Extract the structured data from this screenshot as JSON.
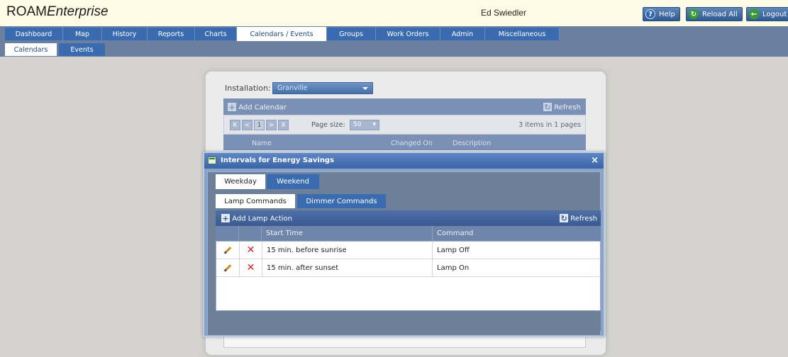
{
  "app": {
    "brand_plain": "ROAM",
    "brand_italic": "Enterprise",
    "user_name": "Ed Swiedler"
  },
  "header_buttons": [
    {
      "label": "Help",
      "icon": "help-icon",
      "color": "#2f64b2"
    },
    {
      "label": "Reload All",
      "icon": "reload-icon",
      "color": "#3a9a32"
    },
    {
      "label": "Logout",
      "icon": "logout-icon",
      "color": "#3a9a32"
    }
  ],
  "nav": {
    "tabs": [
      "Dashboard",
      "Map",
      "History",
      "Reports",
      "Charts",
      "Calendars / Events",
      "Groups",
      "Work Orders",
      "Admin",
      "Miscellaneous"
    ],
    "active": "Calendars / Events"
  },
  "subnav": {
    "tabs": [
      "Calendars",
      "Events"
    ],
    "active": "Calendars"
  },
  "calendars_panel": {
    "installation_label": "Installation:",
    "installation_value": "Granville",
    "add_label": "Add Calendar",
    "refresh_label": "Refresh",
    "pager": {
      "current_page": "1",
      "page_size_label": "Page size:",
      "page_size": "50",
      "summary": "3 items in 1 pages"
    },
    "columns": [
      "Name",
      "Changed On",
      "Description"
    ]
  },
  "dialog": {
    "title": "Intervals for Energy Savings",
    "close_glyph": "×",
    "day_tabs": [
      "Weekday",
      "Weekend"
    ],
    "day_active": "Weekday",
    "cmd_tabs": [
      "Lamp Commands",
      "Dimmer Commands"
    ],
    "cmd_active": "Lamp Commands",
    "add_label": "Add Lamp Action",
    "refresh_label": "Refresh",
    "columns": [
      "Start Time",
      "Command"
    ],
    "rows": [
      {
        "start_time": "15 min. before sunrise",
        "command": "Lamp Off"
      },
      {
        "start_time": "15 min. after sunset",
        "command": "Lamp On"
      }
    ]
  }
}
